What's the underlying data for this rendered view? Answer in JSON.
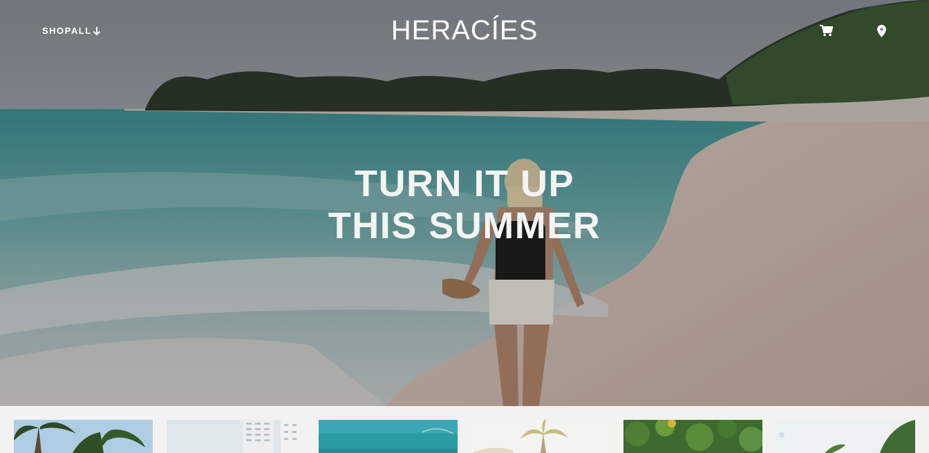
{
  "nav": {
    "shop_label": "SHOPALL",
    "shop_icon": "arrow-down-icon",
    "brand": "HERACÍES",
    "cart_icon": "cart-icon",
    "location_icon": "map-marker-icon"
  },
  "hero": {
    "headline_line1": "TURN IT UP",
    "headline_line2": "THIS SUMMER"
  },
  "thumbnails": [
    {
      "name": "palm-trees-sky"
    },
    {
      "name": "white-building"
    },
    {
      "name": "turquoise-water"
    },
    {
      "name": "palm-tree-bright"
    },
    {
      "name": "green-foliage"
    },
    {
      "name": "palm-leaf-window"
    }
  ],
  "colors": {
    "text": "#ffffff",
    "strip_bg": "#f2f2f2"
  }
}
